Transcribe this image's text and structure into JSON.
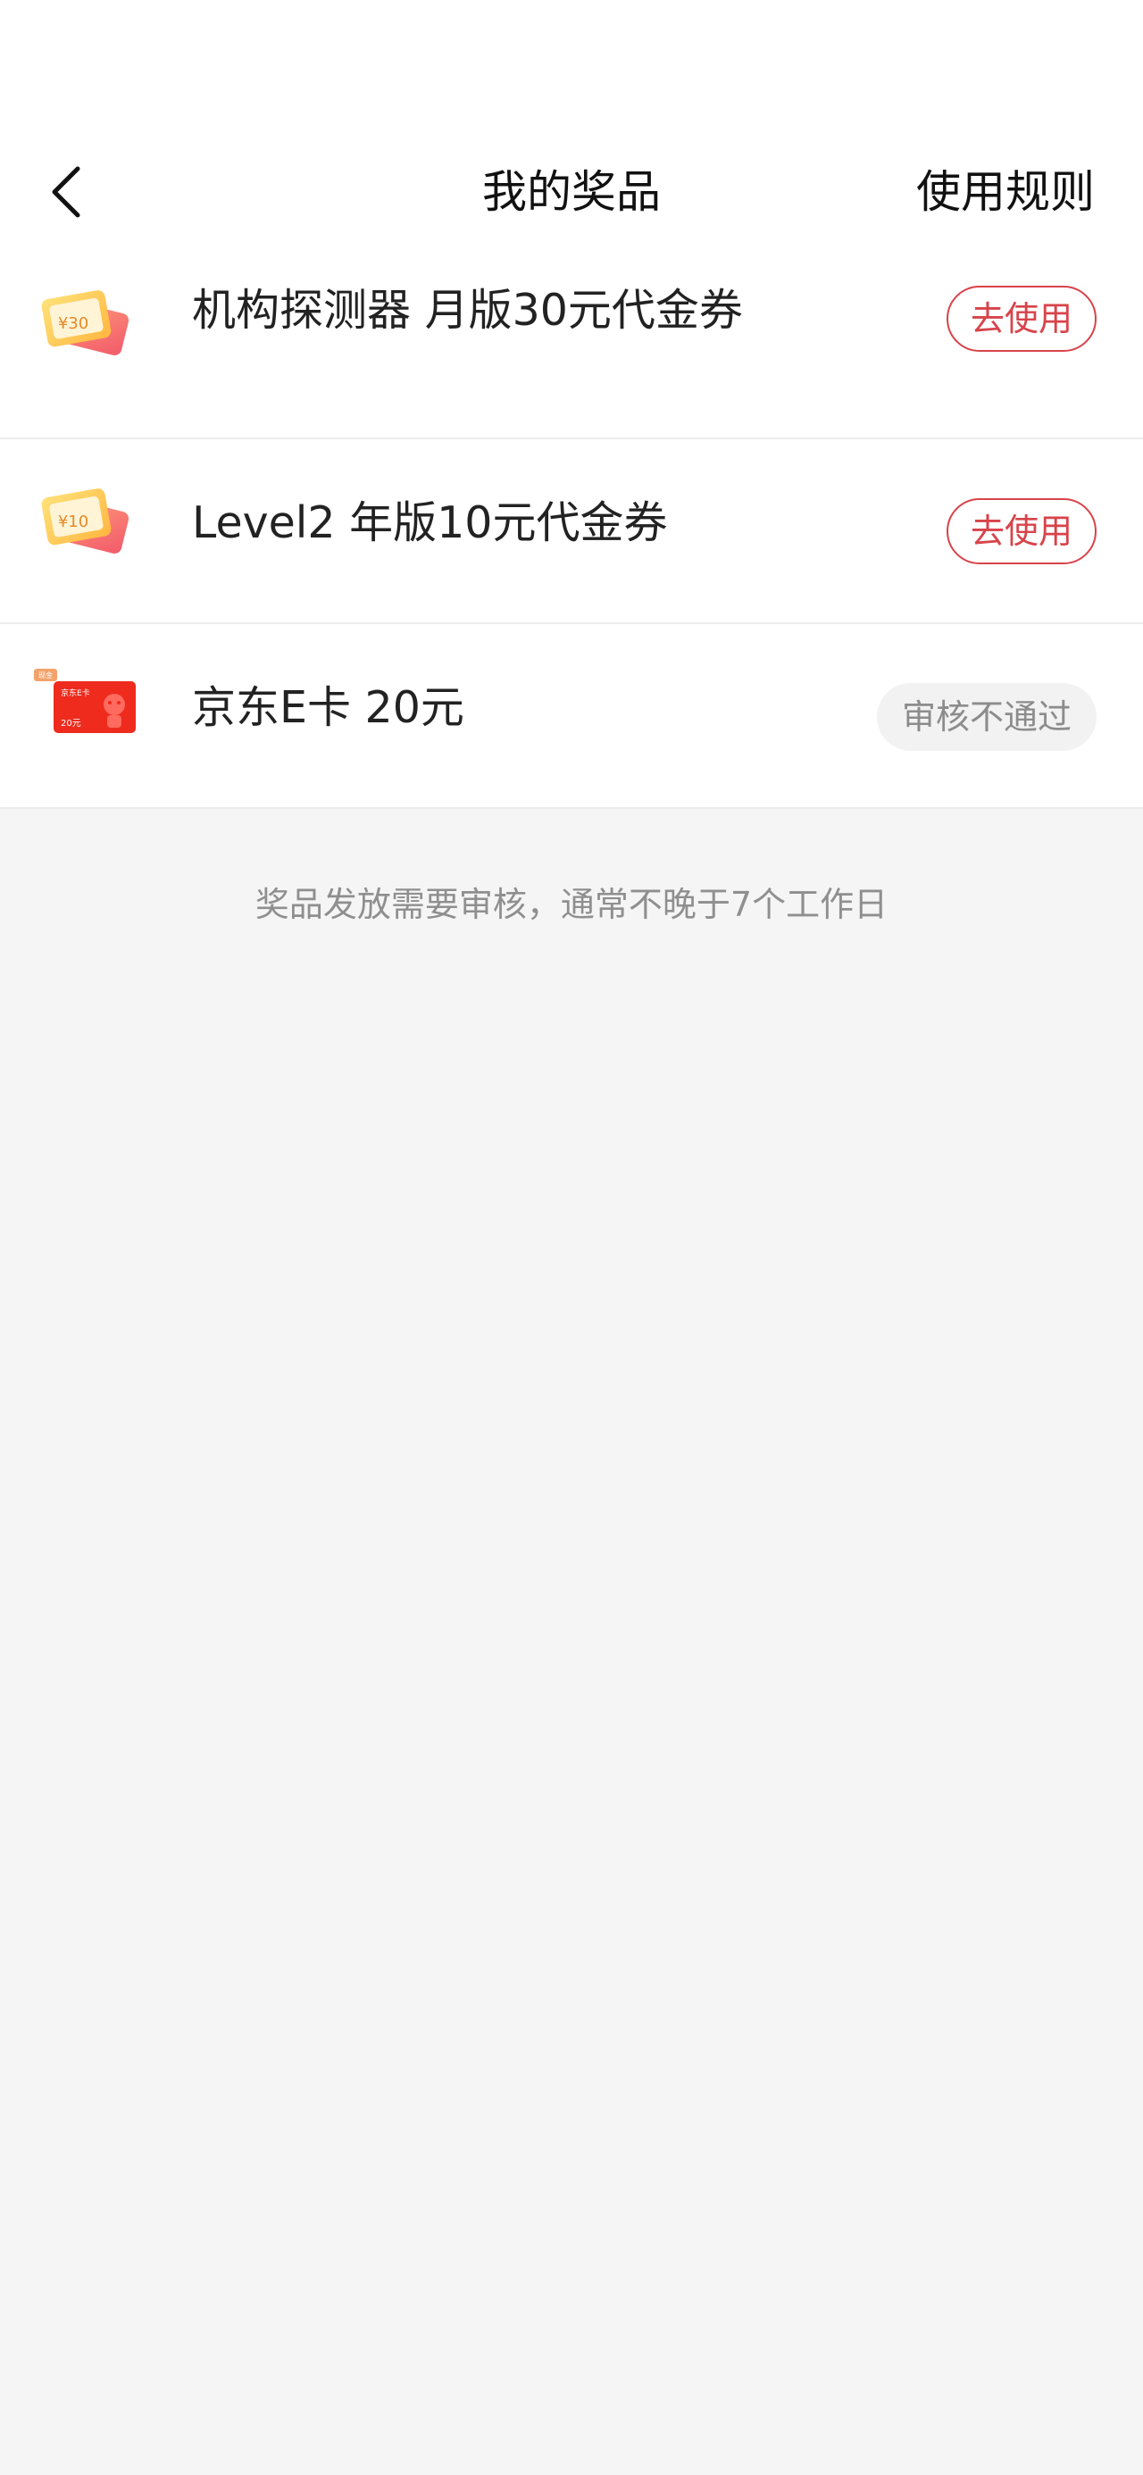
{
  "header": {
    "title": "我的奖品",
    "rules_label": "使用规则"
  },
  "prizes": [
    {
      "name": "机构探测器 月版30元代金券",
      "icon": "coupon-ticket-icon",
      "icon_text": "¥30",
      "action_label": "去使用",
      "status": "usable"
    },
    {
      "name": "Level2 年版10元代金券",
      "icon": "coupon-ticket-icon",
      "icon_text": "¥10",
      "action_label": "去使用",
      "status": "usable"
    },
    {
      "name": "京东E卡 20元",
      "icon": "jd-ecard-icon",
      "icon_tag": "现金",
      "icon_title": "京东E卡",
      "icon_amount": "20元",
      "action_label": "审核不通过",
      "status": "rejected"
    }
  ],
  "notice": "奖品发放需要审核，通常不晚于7个工作日",
  "colors": {
    "accent": "#d8434a",
    "background": "#f5f5f5",
    "tag_bg": "#f2f2f2"
  }
}
